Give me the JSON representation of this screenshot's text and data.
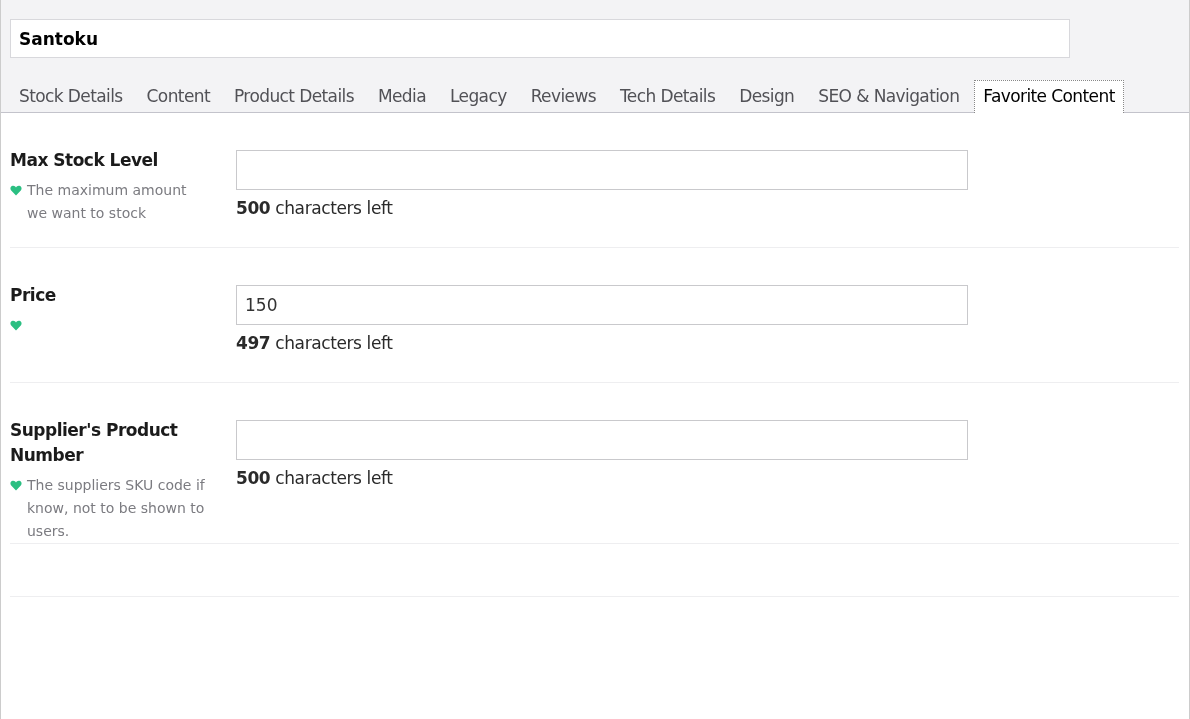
{
  "name_field": {
    "value": "Santoku"
  },
  "tabs": [
    {
      "label": "Stock Details",
      "selected": false
    },
    {
      "label": "Content",
      "selected": false
    },
    {
      "label": "Product Details",
      "selected": false
    },
    {
      "label": "Media",
      "selected": false
    },
    {
      "label": "Legacy",
      "selected": false
    },
    {
      "label": "Reviews",
      "selected": false
    },
    {
      "label": "Tech Details",
      "selected": false
    },
    {
      "label": "Design",
      "selected": false
    },
    {
      "label": "SEO & Navigation",
      "selected": false
    },
    {
      "label": "Favorite Content",
      "selected": true
    }
  ],
  "properties": [
    {
      "label": "Max Stock Level",
      "description": "The maximum amount we want to stock",
      "counter": "**500** characters left"
    },
    {
      "label": "Price",
      "value": "150",
      "counter": "**497** characters left"
    },
    {
      "label": "Supplier's Product Number",
      "description": "The suppliers SKU code if know, not to be shown to users.",
      "counter": "**500** characters left"
    }
  ]
}
